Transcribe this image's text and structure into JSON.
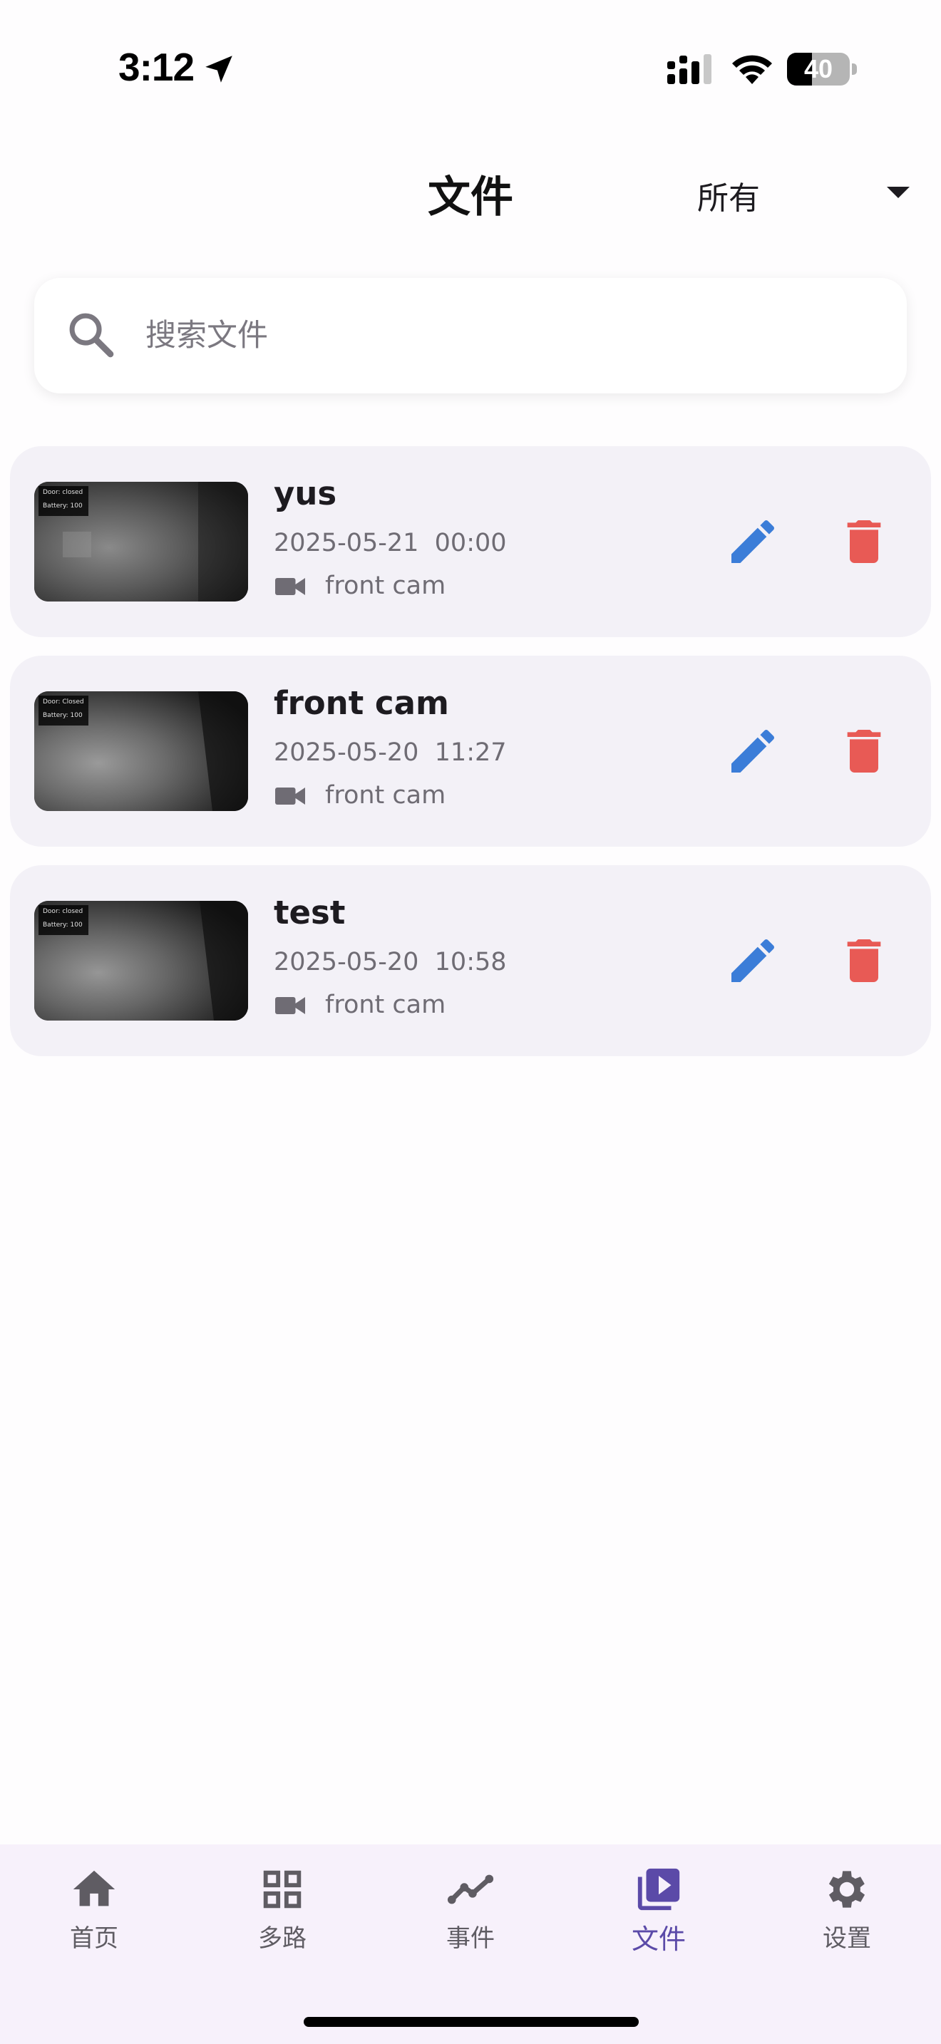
{
  "status_bar": {
    "time": "3:12",
    "battery_level": 40,
    "battery_label": "40"
  },
  "header": {
    "title": "文件",
    "filter_value": "所有"
  },
  "search": {
    "placeholder": "搜索文件"
  },
  "files": [
    {
      "name": "yus",
      "date": "2025-05-21  00:00",
      "camera": "front cam",
      "thumb_lines": [
        "Door: closed",
        "Battery: 100"
      ]
    },
    {
      "name": "front cam",
      "date": "2025-05-20  11:27",
      "camera": "front cam",
      "thumb_lines": [
        "Door: Closed",
        "Battery: 100"
      ]
    },
    {
      "name": "test",
      "date": "2025-05-20  10:58",
      "camera": "front cam",
      "thumb_lines": [
        "Door: closed",
        "Battery: 100"
      ]
    }
  ],
  "bottom_nav": {
    "items": [
      {
        "label": "首页",
        "icon": "home-icon"
      },
      {
        "label": "多路",
        "icon": "grid-icon"
      },
      {
        "label": "事件",
        "icon": "trend-icon"
      },
      {
        "label": "文件",
        "icon": "video-library-icon",
        "active": true
      },
      {
        "label": "设置",
        "icon": "gear-icon"
      }
    ]
  },
  "colors": {
    "edit": "#3b7dd8",
    "delete": "#e85a55",
    "active_nav": "#5b4aa8",
    "card_bg": "#f3f1f7"
  }
}
